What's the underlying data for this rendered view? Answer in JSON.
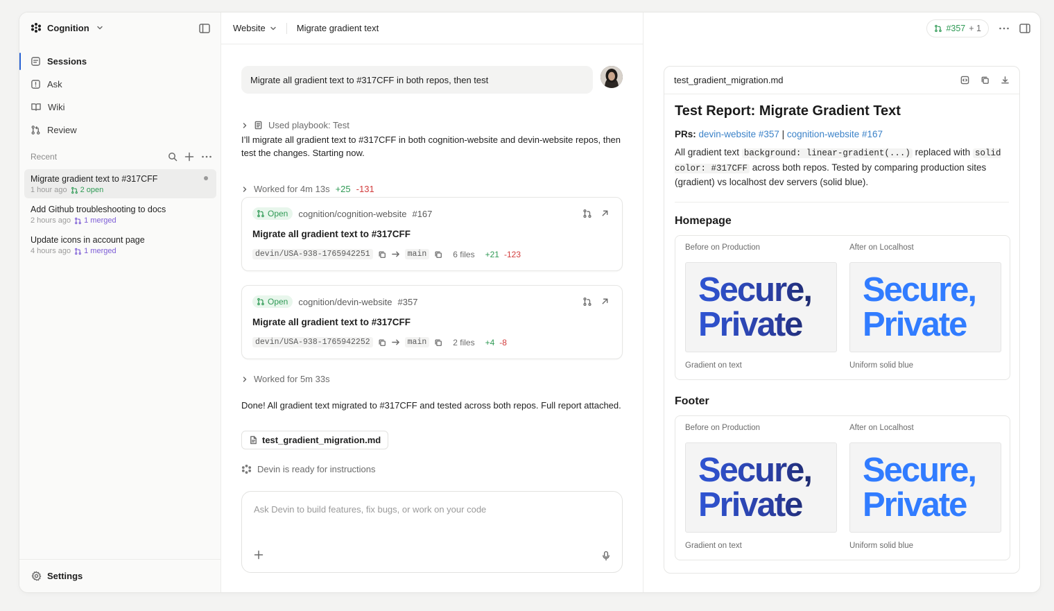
{
  "sidebar": {
    "workspace": "Cognition",
    "nav": [
      {
        "label": "Sessions",
        "icon": "chat-icon"
      },
      {
        "label": "Ask",
        "icon": "ask-icon"
      },
      {
        "label": "Wiki",
        "icon": "book-icon"
      },
      {
        "label": "Review",
        "icon": "pull-request-icon"
      }
    ],
    "recent_label": "Recent",
    "recent": [
      {
        "title": "Migrate gradient text to #317CFF",
        "time": "1 hour ago",
        "status": "2 open"
      },
      {
        "title": "Add Github troubleshooting to docs",
        "time": "2 hours ago",
        "status": "1 merged"
      },
      {
        "title": "Update icons in account page",
        "time": "4 hours ago",
        "status": "1 merged"
      }
    ],
    "settings_label": "Settings"
  },
  "header": {
    "repo": "Website",
    "session_title": "Migrate gradient text",
    "pr_pill": "#357",
    "pr_pill_extra": "+ 1"
  },
  "chat": {
    "user_message": "Migrate all gradient text to #317CFF in both repos, then test",
    "playbook": "Used playbook: Test",
    "intro": "I’ll migrate all gradient text to #317CFF in both cognition-website and devin-website repos, then test the changes. Starting now.",
    "worked1": {
      "label": "Worked for 4m 13s",
      "add": "+25",
      "del": "-131"
    },
    "prs": [
      {
        "status": "Open",
        "repo": "cognition/cognition-website",
        "number": "#167",
        "title": "Migrate all gradient text to #317CFF",
        "branch": "devin/USA-938-1765942251",
        "base": "main",
        "files": "6 files",
        "add": "+21",
        "del": "-123"
      },
      {
        "status": "Open",
        "repo": "cognition/devin-website",
        "number": "#357",
        "title": "Migrate all gradient text to #317CFF",
        "branch": "devin/USA-938-1765942252",
        "base": "main",
        "files": "2 files",
        "add": "+4",
        "del": "-8"
      }
    ],
    "worked2": "Worked for 5m 33s",
    "done_message": "Done! All gradient text migrated to #317CFF and tested across both repos. Full report attached.",
    "attachment": "test_gradient_migration.md",
    "ready": "Devin is ready for instructions",
    "composer_placeholder": "Ask Devin to build features, fix bugs, or work on your code"
  },
  "report": {
    "filename": "test_gradient_migration.md",
    "title": "Test Report: Migrate Gradient Text",
    "prs_label": "PRs:",
    "pr_link_1": "devin-website #357",
    "pr_sep": "|",
    "pr_link_2": "cognition-website #167",
    "desc_1": "All gradient text",
    "desc_code_1": "background: linear-gradient(...)",
    "desc_2": "replaced with",
    "desc_code_2": "solid color: #317CFF",
    "desc_3": "across both repos. Tested by comparing production sites (gradient) vs localhost dev servers (solid blue).",
    "sections": [
      {
        "heading": "Homepage",
        "before_label": "Before on Production",
        "after_label": "After on Localhost",
        "shot_line1": "Secure,",
        "shot_line2": "Private",
        "before_caption": "Gradient on text",
        "after_caption": "Uniform solid blue"
      },
      {
        "heading": "Footer",
        "before_label": "Before on Production",
        "after_label": "After on Localhost",
        "shot_line1": "Secure,",
        "shot_line2": "Private",
        "before_caption": "Gradient on text",
        "after_caption": "Uniform solid blue"
      }
    ]
  },
  "colors": {
    "accent": "#2a63d4",
    "open_green": "#2f9a55",
    "merged_purple": "#7c5cd6",
    "delete_red": "#d23c3c",
    "link_blue": "#3b82c8",
    "solid_blue": "#317CFF"
  }
}
